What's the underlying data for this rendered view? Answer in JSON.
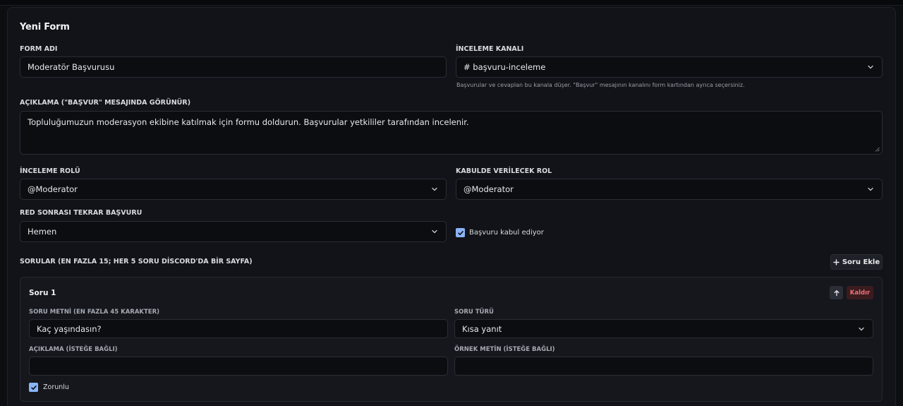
{
  "form": {
    "title": "Yeni Form",
    "name_label": "FORM ADI",
    "name_value": "Moderatör Başvurusu",
    "channel_label": "İNCELEME KANALI",
    "channel_value": "# başvuru-inceleme",
    "channel_hint": "Başvurular ve cevaplan bu kanala düşer. \"Başvur\" mesajının kanalını form kartından ayrıca seçersiniz.",
    "description_label": "AÇIKLAMA (\"BAŞVUR\" MESAJINDA GÖRÜNÜR)",
    "description_value": "Topluluğumuzun moderasyon ekibine katılmak için formu doldurun. Başvurular yetkililer tarafından incelenir.",
    "review_role_label": "İNCELEME ROLÜ",
    "review_role_value": "@Moderator",
    "accept_role_label": "KABULDE VERİLECEK ROL",
    "accept_role_value": "@Moderator",
    "reapply_label": "RED SONRASI TEKRAR BAŞVURU",
    "reapply_value": "Hemen",
    "accepting_label": "Başvuru kabul ediyor",
    "accepting_checked": true
  },
  "questions": {
    "header": "SORULAR (EN FAZLA 15; HER 5 SORU DİSCORD'DA BİR SAYFA)",
    "add_button": "Soru Ekle",
    "items": [
      {
        "title": "Soru 1",
        "remove_label": "Kaldır",
        "text_label": "SORU METNİ (EN FAZLA 45 KARAKTER)",
        "text_value": "Kaç yaşındasın?",
        "type_label": "SORU TÜRÜ",
        "type_value": "Kısa yanıt",
        "desc_label": "AÇIKLAMA (İSTEĞE BAĞLI)",
        "desc_value": "",
        "placeholder_label": "ÖRNEK METİN (İSTEĞE BAĞLI)",
        "placeholder_value": "",
        "required_label": "Zorunlu",
        "required_checked": true
      }
    ]
  },
  "colors": {
    "accent": "#8ab4f8",
    "danger": "#f07178",
    "background": "#0d0e12",
    "card": "#111318"
  }
}
